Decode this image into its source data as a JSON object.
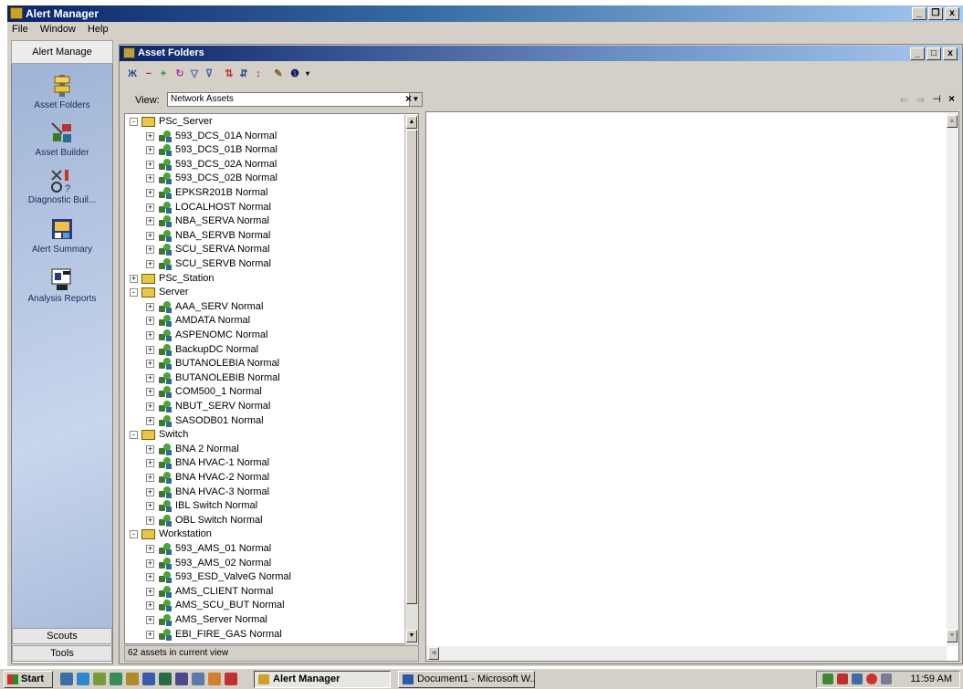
{
  "app": {
    "title": "Alert Manager"
  },
  "menu": [
    "File",
    "Window",
    "Help"
  ],
  "sidebar": {
    "header": "Alert Manage",
    "items": [
      {
        "label": "Asset Folders",
        "icon": "asset-folders-icon"
      },
      {
        "label": "Asset Builder",
        "icon": "asset-builder-icon"
      },
      {
        "label": "Diagnostic Buil...",
        "icon": "diagnostic-builder-icon"
      },
      {
        "label": "Alert Summary",
        "icon": "alert-summary-icon"
      },
      {
        "label": "Analysis Reports",
        "icon": "analysis-reports-icon"
      }
    ],
    "bottom": [
      "Scouts",
      "Tools"
    ]
  },
  "child_window": {
    "title": "Asset Folders"
  },
  "view": {
    "label": "View:",
    "value": "Network Assets"
  },
  "tree": [
    {
      "label": "PSc_Server",
      "type": "folder",
      "level": 0,
      "state": "-"
    },
    {
      "label": "593_DCS_01A Normal",
      "type": "asset",
      "level": 1,
      "state": "+"
    },
    {
      "label": "593_DCS_01B Normal",
      "type": "asset",
      "level": 1,
      "state": "+"
    },
    {
      "label": "593_DCS_02A Normal",
      "type": "asset",
      "level": 1,
      "state": "+"
    },
    {
      "label": "593_DCS_02B Normal",
      "type": "asset",
      "level": 1,
      "state": "+"
    },
    {
      "label": "EPKSR201B Normal",
      "type": "asset",
      "level": 1,
      "state": "+"
    },
    {
      "label": "LOCALHOST Normal",
      "type": "asset",
      "level": 1,
      "state": "+"
    },
    {
      "label": "NBA_SERVA Normal",
      "type": "asset",
      "level": 1,
      "state": "+"
    },
    {
      "label": "NBA_SERVB Normal",
      "type": "asset",
      "level": 1,
      "state": "+"
    },
    {
      "label": "SCU_SERVA Normal",
      "type": "asset",
      "level": 1,
      "state": "+"
    },
    {
      "label": "SCU_SERVB Normal",
      "type": "asset",
      "level": 1,
      "state": "+"
    },
    {
      "label": "PSc_Station",
      "type": "folder",
      "level": 0,
      "state": "+"
    },
    {
      "label": "Server",
      "type": "folder",
      "level": 0,
      "state": "-"
    },
    {
      "label": "AAA_SERV Normal",
      "type": "asset",
      "level": 1,
      "state": "+"
    },
    {
      "label": "AMDATA Normal",
      "type": "asset",
      "level": 1,
      "state": "+"
    },
    {
      "label": "ASPENOMC Normal",
      "type": "asset",
      "level": 1,
      "state": "+"
    },
    {
      "label": "BackupDC Normal",
      "type": "asset",
      "level": 1,
      "state": "+"
    },
    {
      "label": "BUTANOLEBIA Normal",
      "type": "asset",
      "level": 1,
      "state": "+"
    },
    {
      "label": "BUTANOLEBIB Normal",
      "type": "asset",
      "level": 1,
      "state": "+"
    },
    {
      "label": "COM500_1 Normal",
      "type": "asset",
      "level": 1,
      "state": "+"
    },
    {
      "label": "NBUT_SERV Normal",
      "type": "asset",
      "level": 1,
      "state": "+"
    },
    {
      "label": "SASODB01 Normal",
      "type": "asset",
      "level": 1,
      "state": "+"
    },
    {
      "label": "Switch",
      "type": "folder",
      "level": 0,
      "state": "-"
    },
    {
      "label": "BNA 2 Normal",
      "type": "asset",
      "level": 1,
      "state": "+"
    },
    {
      "label": "BNA HVAC-1 Normal",
      "type": "asset",
      "level": 1,
      "state": "+"
    },
    {
      "label": "BNA HVAC-2 Normal",
      "type": "asset",
      "level": 1,
      "state": "+"
    },
    {
      "label": "BNA HVAC-3 Normal",
      "type": "asset",
      "level": 1,
      "state": "+"
    },
    {
      "label": "IBL Switch Normal",
      "type": "asset",
      "level": 1,
      "state": "+"
    },
    {
      "label": "OBL Switch Normal",
      "type": "asset",
      "level": 1,
      "state": "+"
    },
    {
      "label": "Workstation",
      "type": "folder",
      "level": 0,
      "state": "-"
    },
    {
      "label": "593_AMS_01 Normal",
      "type": "asset",
      "level": 1,
      "state": "+"
    },
    {
      "label": "593_AMS_02 Normal",
      "type": "asset",
      "level": 1,
      "state": "+"
    },
    {
      "label": "593_ESD_ValveG Normal",
      "type": "asset",
      "level": 1,
      "state": "+"
    },
    {
      "label": "AMS_CLIENT Normal",
      "type": "asset",
      "level": 1,
      "state": "+"
    },
    {
      "label": "AMS_SCU_BUT Normal",
      "type": "asset",
      "level": 1,
      "state": "+"
    },
    {
      "label": "AMS_Server Normal",
      "type": "asset",
      "level": 1,
      "state": "+"
    },
    {
      "label": "EBI_FIRE_GAS Normal",
      "type": "asset",
      "level": 1,
      "state": "+"
    }
  ],
  "status": "62 assets in current view",
  "taskbar": {
    "start": "Start",
    "tasks": [
      {
        "label": "Alert Manager",
        "active": true
      },
      {
        "label": "Document1 - Microsoft W...",
        "active": false
      }
    ],
    "clock": "11:59 AM"
  },
  "colors": {
    "titlebar": "#0a246a",
    "sidebar": "#b8c9e4",
    "chrome": "#d4d0c8"
  }
}
